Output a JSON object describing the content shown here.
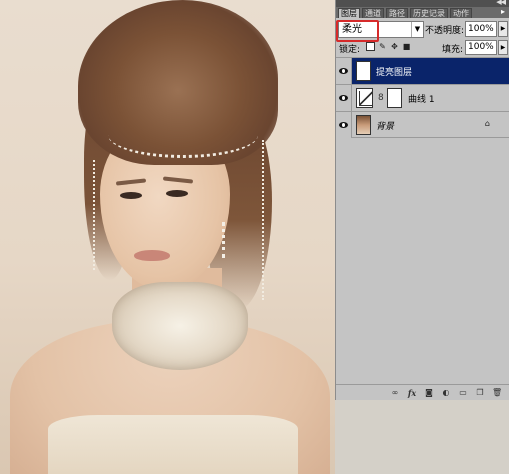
{
  "panel": {
    "collapse_arrows": "◀◀",
    "tabs": [
      {
        "label": "图层",
        "active": true
      },
      {
        "label": "通道",
        "active": false
      },
      {
        "label": "路径",
        "active": false
      },
      {
        "label": "历史记录",
        "active": false
      },
      {
        "label": "动作",
        "active": false
      }
    ],
    "menu_arrow": "▸",
    "blend_mode": "柔光",
    "opacity_label": "不透明度:",
    "opacity_value": "100%",
    "lock_label": "锁定:",
    "fill_label": "填充:",
    "fill_value": "100%",
    "layers": [
      {
        "name": "提亮图层",
        "selected": true,
        "type": "normal"
      },
      {
        "name": "曲线 1",
        "selected": false,
        "type": "adjustment"
      },
      {
        "name": "背景",
        "selected": false,
        "type": "background"
      }
    ]
  },
  "colors": {
    "selection_blue": "#0a246a",
    "highlight_red": "#d62a2a",
    "panel_gray": "#c4c4c4"
  },
  "icons": [
    "eye-icon",
    "chain-link-icon",
    "lock-icon",
    "link-layers-icon",
    "fx-icon",
    "mask-icon",
    "adjustment-icon",
    "group-folder-icon",
    "new-layer-icon",
    "trash-icon"
  ]
}
